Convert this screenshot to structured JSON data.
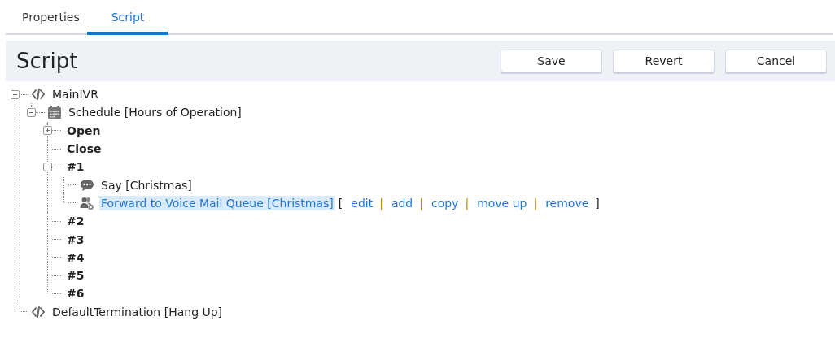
{
  "tabs": [
    {
      "label": "Properties",
      "selected": false
    },
    {
      "label": "Script",
      "selected": true
    }
  ],
  "header": {
    "title": "Script",
    "buttons": [
      "Save",
      "Revert",
      "Cancel"
    ]
  },
  "tree": [
    {
      "label": "MainIVR",
      "kind": "script",
      "expanded": true,
      "selected": false,
      "children": [
        {
          "label": "Schedule [Hours of Operation]",
          "kind": "schedule",
          "expanded": true,
          "selected": false,
          "children": [
            {
              "label": "Open",
              "kind": "branch",
              "expanded": false,
              "selected": false
            },
            {
              "label": "Close",
              "kind": "branch",
              "selected": false
            },
            {
              "label": "#1",
              "kind": "branch",
              "expanded": true,
              "selected": false,
              "children": [
                {
                  "label": "Say [Christmas]",
                  "kind": "say",
                  "selected": false
                },
                {
                  "label": "Forward to Voice Mail Queue [Christmas]",
                  "kind": "forward",
                  "selected": true,
                  "actions": [
                    {
                      "kind": "bracket",
                      "text": "["
                    },
                    {
                      "kind": "link",
                      "text": "edit"
                    },
                    {
                      "kind": "separator",
                      "text": "|"
                    },
                    {
                      "kind": "link",
                      "text": "add"
                    },
                    {
                      "kind": "separator",
                      "text": "|"
                    },
                    {
                      "kind": "link",
                      "text": "copy"
                    },
                    {
                      "kind": "separator",
                      "text": "|"
                    },
                    {
                      "kind": "link",
                      "text": "move up"
                    },
                    {
                      "kind": "separator",
                      "text": "|"
                    },
                    {
                      "kind": "link",
                      "text": "remove"
                    },
                    {
                      "kind": "bracket",
                      "text": "]"
                    }
                  ]
                }
              ]
            },
            {
              "label": "#2",
              "kind": "branch",
              "selected": false
            },
            {
              "label": "#3",
              "kind": "branch",
              "selected": false
            },
            {
              "label": "#4",
              "kind": "branch",
              "selected": false
            },
            {
              "label": "#5",
              "kind": "branch",
              "selected": false
            },
            {
              "label": "#6",
              "kind": "branch",
              "selected": false
            }
          ]
        }
      ]
    },
    {
      "label": "DefaultTermination [Hang Up]",
      "kind": "script",
      "selected": false
    }
  ]
}
